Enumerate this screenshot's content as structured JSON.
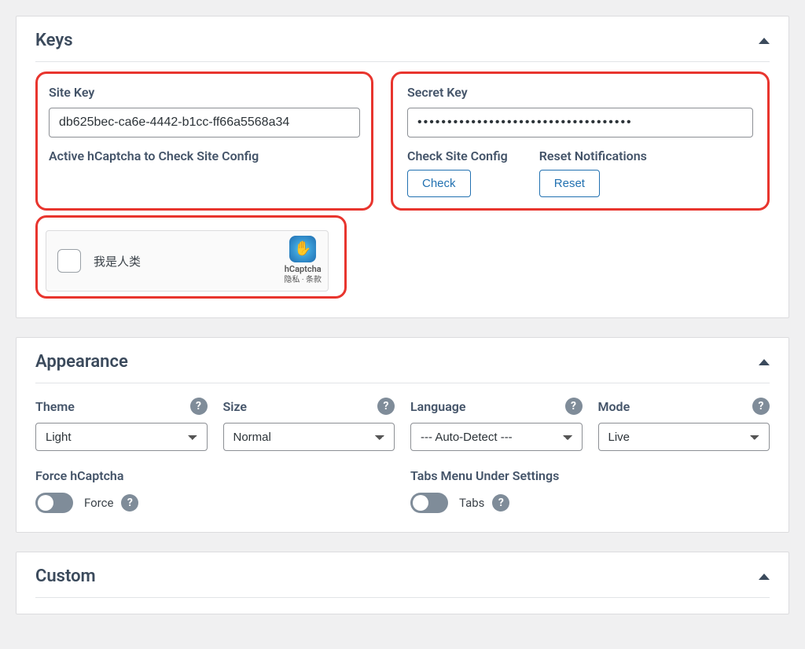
{
  "keys": {
    "title": "Keys",
    "site_key_label": "Site Key",
    "site_key_value": "db625bec-ca6e-4442-b1cc-ff66a5568a34",
    "active_label": "Active hCaptcha to Check Site Config",
    "captcha_text": "我是人类",
    "captcha_brand": "hCaptcha",
    "captcha_privacy": "隐私",
    "captcha_terms": "条款",
    "captcha_sep": " · ",
    "secret_key_label": "Secret Key",
    "secret_key_value": "••••••••••••••••••••••••••••••••••••",
    "check_label": "Check Site Config",
    "check_btn": "Check",
    "reset_label": "Reset Notifications",
    "reset_btn": "Reset"
  },
  "appearance": {
    "title": "Appearance",
    "theme_label": "Theme",
    "theme_value": "Light",
    "size_label": "Size",
    "size_value": "Normal",
    "language_label": "Language",
    "language_value": "--- Auto-Detect ---",
    "mode_label": "Mode",
    "mode_value": "Live",
    "force_label": "Force hCaptcha",
    "force_toggle": "Force",
    "tabs_label": "Tabs Menu Under Settings",
    "tabs_toggle": "Tabs"
  },
  "custom": {
    "title": "Custom"
  }
}
